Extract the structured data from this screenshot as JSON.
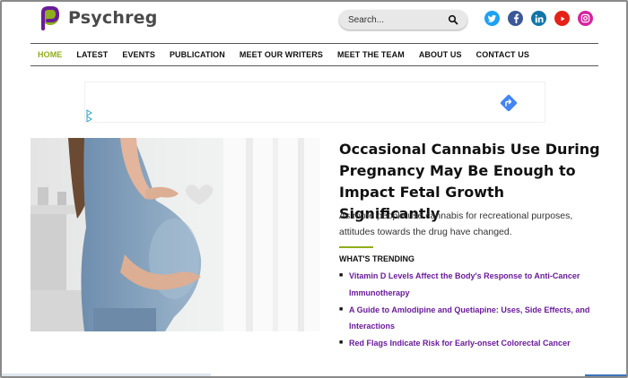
{
  "site": {
    "name": "Psychreg"
  },
  "search": {
    "placeholder": "Search..."
  },
  "socials": [
    {
      "name": "twitter",
      "glyph": "t",
      "color": "#1da1f2"
    },
    {
      "name": "facebook",
      "glyph": "f",
      "color": "#3b5998"
    },
    {
      "name": "linkedin",
      "glyph": "in",
      "color": "#0e76a8"
    },
    {
      "name": "youtube",
      "glyph": "▶",
      "color": "#e62117"
    },
    {
      "name": "instagram",
      "glyph": "◎",
      "color": "#d6249f"
    }
  ],
  "nav": {
    "items": [
      "HOME",
      "LATEST",
      "EVENTS",
      "PUBLICATION",
      "MEET OUR WRITERS",
      "MEET THE TEAM",
      "ABOUT US",
      "CONTACT US"
    ],
    "active": "HOME",
    "accent": "#8fae1b"
  },
  "article": {
    "headline": "Occasional Cannabis Use During Pregnancy May Be Enough to Impact Fetal Growth Significantly",
    "excerpt": "As more people use cannabis for recreational purposes, attitudes towards the drug have changed."
  },
  "trending": {
    "title": "WHAT'S TRENDING",
    "items": [
      "Vitamin D Levels Affect the Body's Response to Anti-Cancer Immunotherapy",
      "A Guide to Amlodipine and Quetiapine: Uses, Side Effects, and Interactions",
      "Red Flags Indicate Risk for Early-onset Colorectal Cancer"
    ],
    "link_color": "#6a1b9a"
  }
}
